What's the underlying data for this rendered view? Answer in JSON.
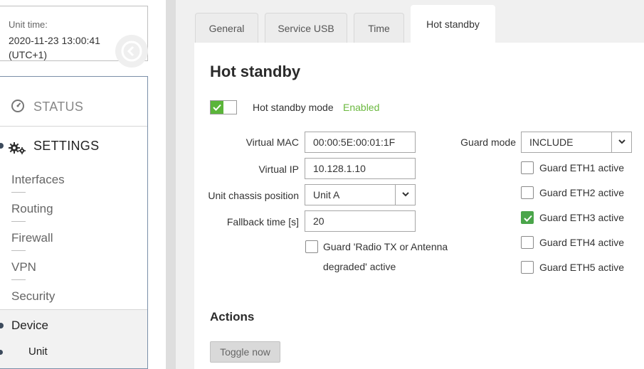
{
  "unit_time": {
    "label": "Unit time:",
    "date": "2020-11-23 13:00:41",
    "tz": "(UTC+1)"
  },
  "nav": {
    "status": "STATUS",
    "settings": "SETTINGS",
    "settings_items": [
      "Interfaces",
      "Routing",
      "Firewall",
      "VPN",
      "Security"
    ],
    "device": "Device",
    "unit": "Unit"
  },
  "tabs": [
    "General",
    "Service USB",
    "Time",
    "Hot standby"
  ],
  "page": {
    "title": "Hot standby",
    "mode_label": "Hot standby mode",
    "mode_state": "Enabled",
    "mode_enabled": true
  },
  "form": {
    "virtual_mac_label": "Virtual MAC",
    "virtual_mac": "00:00:5E:00:01:1F",
    "virtual_ip_label": "Virtual IP",
    "virtual_ip": "10.128.1.10",
    "chassis_label": "Unit chassis position",
    "chassis_value": "Unit A",
    "fallback_label": "Fallback time [s]",
    "fallback_value": "20",
    "guard_radio_line1": "Guard 'Radio TX or Antenna",
    "guard_radio_line2": "degraded' active",
    "guard_radio_checked": false,
    "guard_mode_label": "Guard mode",
    "guard_mode_value": "INCLUDE",
    "guards": [
      {
        "label": "Guard ETH1 active",
        "checked": false
      },
      {
        "label": "Guard ETH2 active",
        "checked": false
      },
      {
        "label": "Guard ETH3 active",
        "checked": true
      },
      {
        "label": "Guard ETH4 active",
        "checked": false
      },
      {
        "label": "Guard ETH5 active",
        "checked": false
      }
    ]
  },
  "actions": {
    "title": "Actions",
    "toggle_button": "Toggle now"
  },
  "colors": {
    "accent_green": "#5bb53a",
    "enabled_text": "#6bb93f",
    "nav_border": "#7a8fa8"
  }
}
